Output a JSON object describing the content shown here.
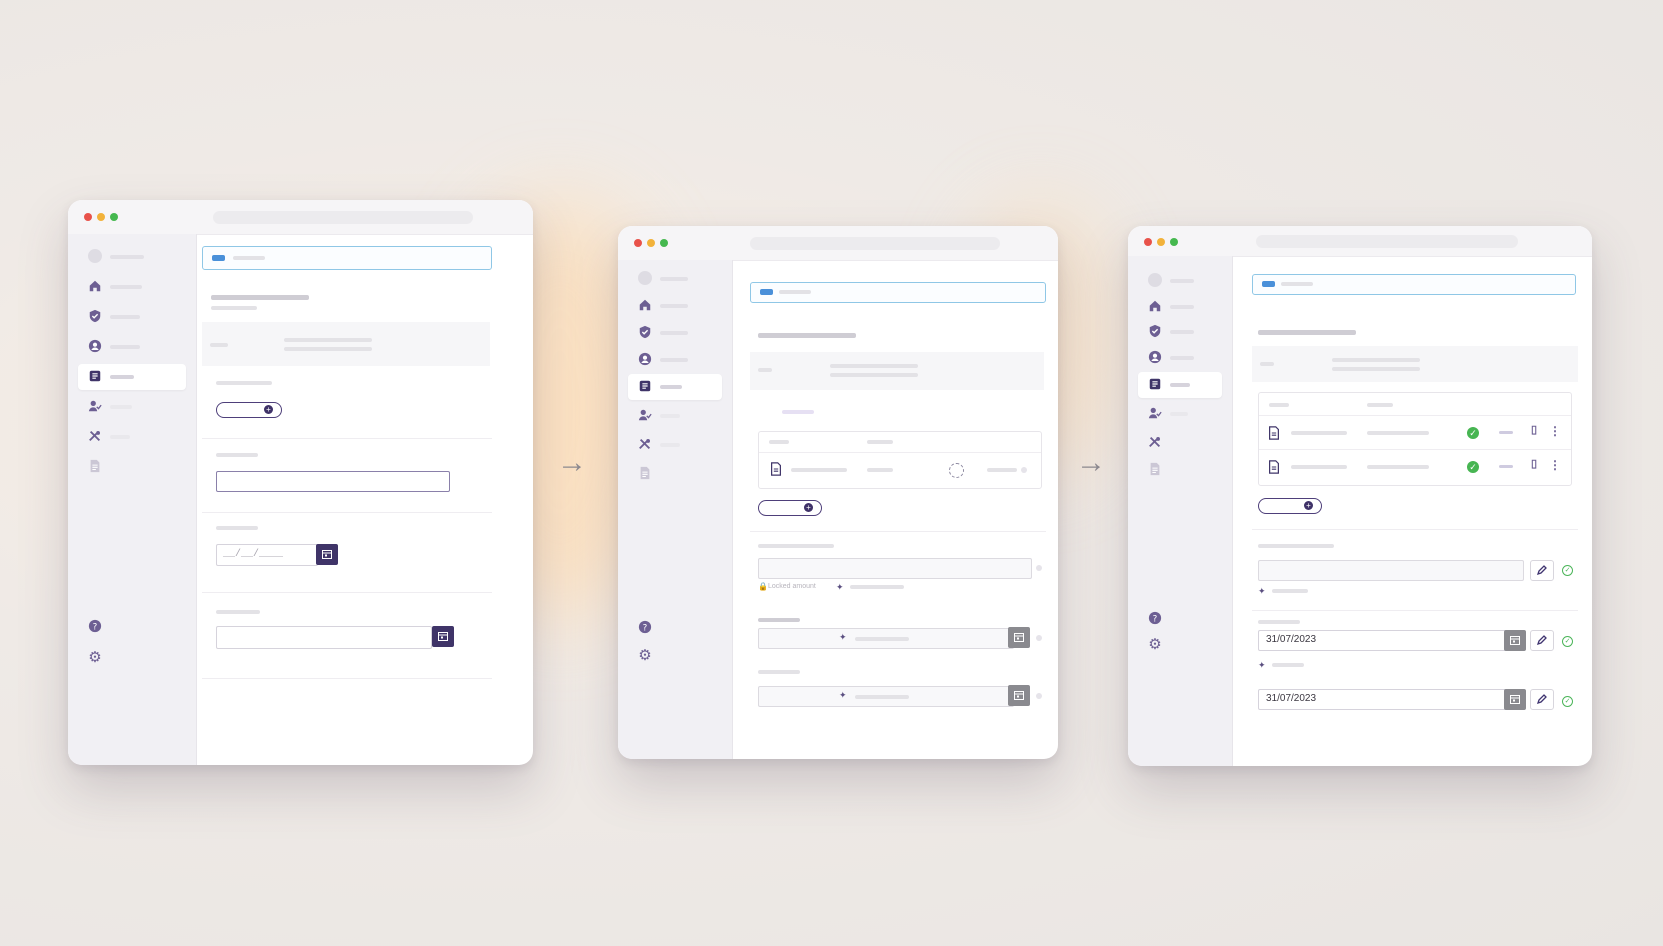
{
  "steps": [
    {
      "date_placeholder": "__/__/____"
    },
    {
      "locked_label": "Locked amount"
    },
    {
      "date_1": "31/07/2023",
      "date_2": "31/07/2023"
    }
  ],
  "icons": [
    "home-icon",
    "shield-icon",
    "user-icon",
    "document-icon",
    "user-check-icon",
    "tools-icon",
    "file-icon",
    "help-icon",
    "gear-icon"
  ],
  "colors": {
    "accent": "#3f3468",
    "banner_border": "#8fc7e6",
    "success": "#47b552",
    "calendar_disabled": "#8a8a8f"
  }
}
